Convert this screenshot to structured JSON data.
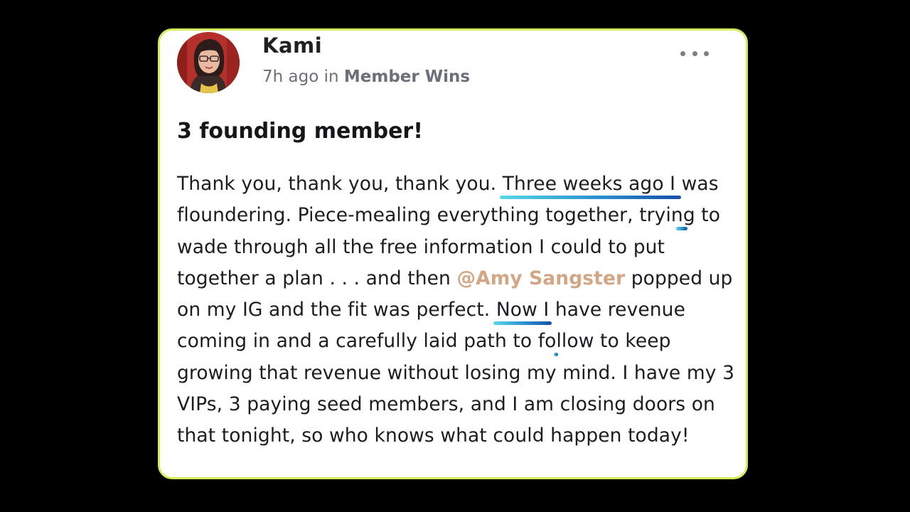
{
  "post": {
    "author": {
      "name": "Kami"
    },
    "meta": {
      "time": "7h ago",
      "in_label": "in",
      "space": "Member Wins"
    },
    "menu_icon": "more-horizontal-icon",
    "title": "3 founding member!",
    "body": {
      "seg1": "Thank you, thank you, thank you.",
      "seg2": "Three weeks ago I",
      "seg3": "was floundering",
      "seg4": ". Piece-mealing everything together, trying to wade through all the free information I could to put together a plan . . . and then",
      "mention": "@Amy Sangster",
      "seg5": "popped up on my IG and the fit was perfect.",
      "seg6": "Now I",
      "seg7": "have revenue coming in",
      "seg8": "and a carefully laid path to follow to keep growing that revenue without losing my mind. I have my 3 VIPs, 3 paying seed members, and I am closing doors on that tonight, so who knows what could happen today!"
    }
  },
  "colors": {
    "card_border": "#d4ec5a",
    "mention": "#d3a785",
    "highlight_start": "#56d8e6",
    "highlight_end": "#1a4fa8"
  }
}
